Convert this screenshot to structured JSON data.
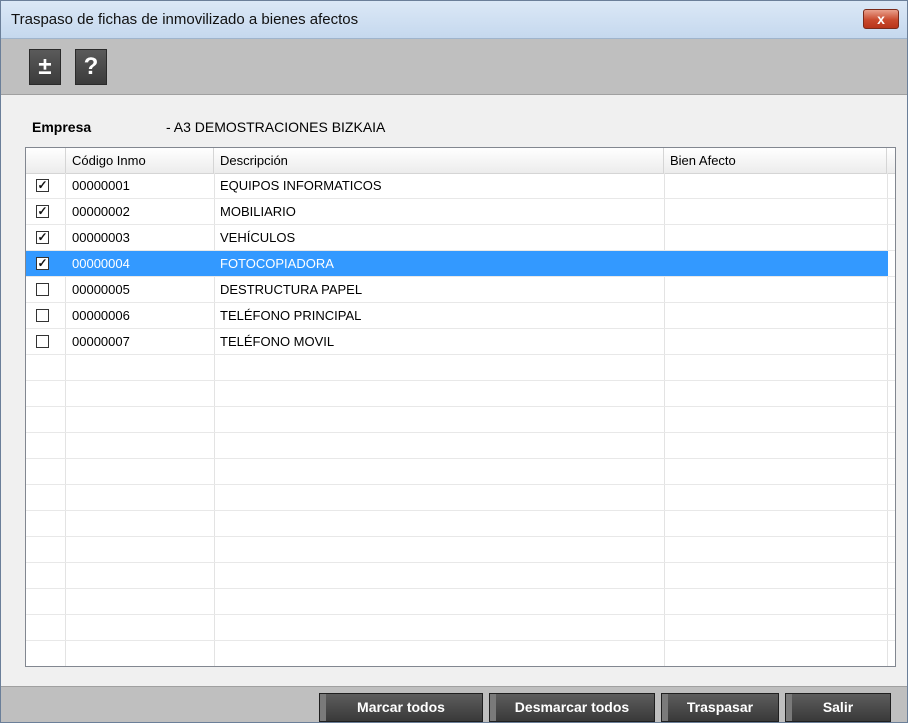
{
  "window": {
    "title": "Traspaso de fichas de inmovilizado a bienes afectos",
    "close_label": "x"
  },
  "toolbar": {
    "expand_label": "±",
    "help_label": "?"
  },
  "empresa": {
    "label": "Empresa",
    "value": "- A3 DEMOSTRACIONES BIZKAIA"
  },
  "grid": {
    "columns": [
      "",
      "Código Inmo",
      "Descripción",
      "Bien Afecto"
    ],
    "rows": [
      {
        "checked": true,
        "codigo": "00000001",
        "descripcion": "EQUIPOS INFORMATICOS",
        "bien_afecto": "",
        "selected": false
      },
      {
        "checked": true,
        "codigo": "00000002",
        "descripcion": "MOBILIARIO",
        "bien_afecto": "",
        "selected": false
      },
      {
        "checked": true,
        "codigo": "00000003",
        "descripcion": "VEHÍCULOS",
        "bien_afecto": "",
        "selected": false
      },
      {
        "checked": true,
        "codigo": "00000004",
        "descripcion": "FOTOCOPIADORA",
        "bien_afecto": "",
        "selected": true
      },
      {
        "checked": false,
        "codigo": "00000005",
        "descripcion": "DESTRUCTURA PAPEL",
        "bien_afecto": "",
        "selected": false
      },
      {
        "checked": false,
        "codigo": "00000006",
        "descripcion": "TELÉFONO PRINCIPAL",
        "bien_afecto": "",
        "selected": false
      },
      {
        "checked": false,
        "codigo": "00000007",
        "descripcion": "TELÉFONO MOVIL",
        "bien_afecto": "",
        "selected": false
      }
    ],
    "checkmark": "✓"
  },
  "buttons": {
    "marcar_todos": "Marcar todos",
    "desmarcar_todos": "Desmarcar todos",
    "traspasar": "Traspasar",
    "salir": "Salir"
  },
  "colors": {
    "selection": "#3399ff",
    "button_dark": "#3b3b3b"
  }
}
